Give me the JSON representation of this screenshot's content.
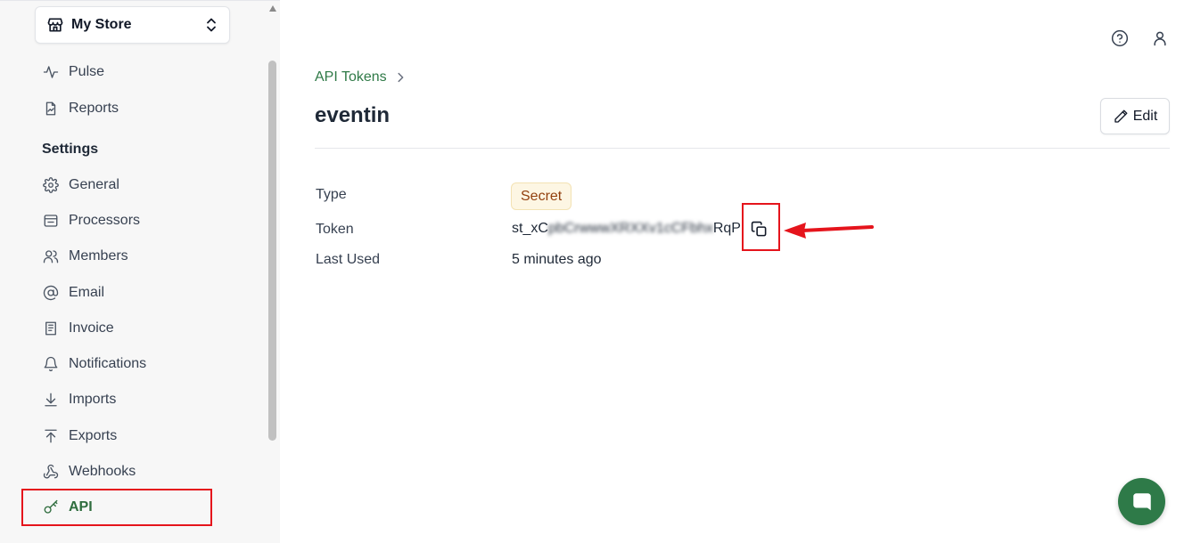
{
  "store": {
    "name": "My Store"
  },
  "sidebar": {
    "top_items": [
      {
        "label": "Pulse",
        "icon": "pulse-icon"
      },
      {
        "label": "Reports",
        "icon": "report-icon"
      }
    ],
    "settings_heading": "Settings",
    "items": [
      {
        "label": "General",
        "icon": "gear-icon"
      },
      {
        "label": "Processors",
        "icon": "processor-icon"
      },
      {
        "label": "Members",
        "icon": "members-icon"
      },
      {
        "label": "Email",
        "icon": "at-icon"
      },
      {
        "label": "Invoice",
        "icon": "invoice-icon"
      },
      {
        "label": "Notifications",
        "icon": "bell-icon"
      },
      {
        "label": "Imports",
        "icon": "download-icon"
      },
      {
        "label": "Exports",
        "icon": "upload-icon"
      },
      {
        "label": "Webhooks",
        "icon": "webhook-icon"
      },
      {
        "label": "API",
        "icon": "key-icon",
        "active": true
      }
    ]
  },
  "breadcrumb": {
    "parent": "API Tokens"
  },
  "page": {
    "title": "eventin",
    "edit_label": "Edit"
  },
  "details": {
    "type_label": "Type",
    "type_value": "Secret",
    "token_label": "Token",
    "token_prefix": "st_xC",
    "token_obscured": "pbCrwwwXRXXv1cCFbhx",
    "token_suffix": "RqP",
    "last_used_label": "Last Used",
    "last_used_value": "5 minutes ago"
  },
  "colors": {
    "accent": "#2f7a47",
    "highlight": "#e5141c",
    "badge_bg": "#fdf6e3",
    "badge_text": "#92400e"
  }
}
